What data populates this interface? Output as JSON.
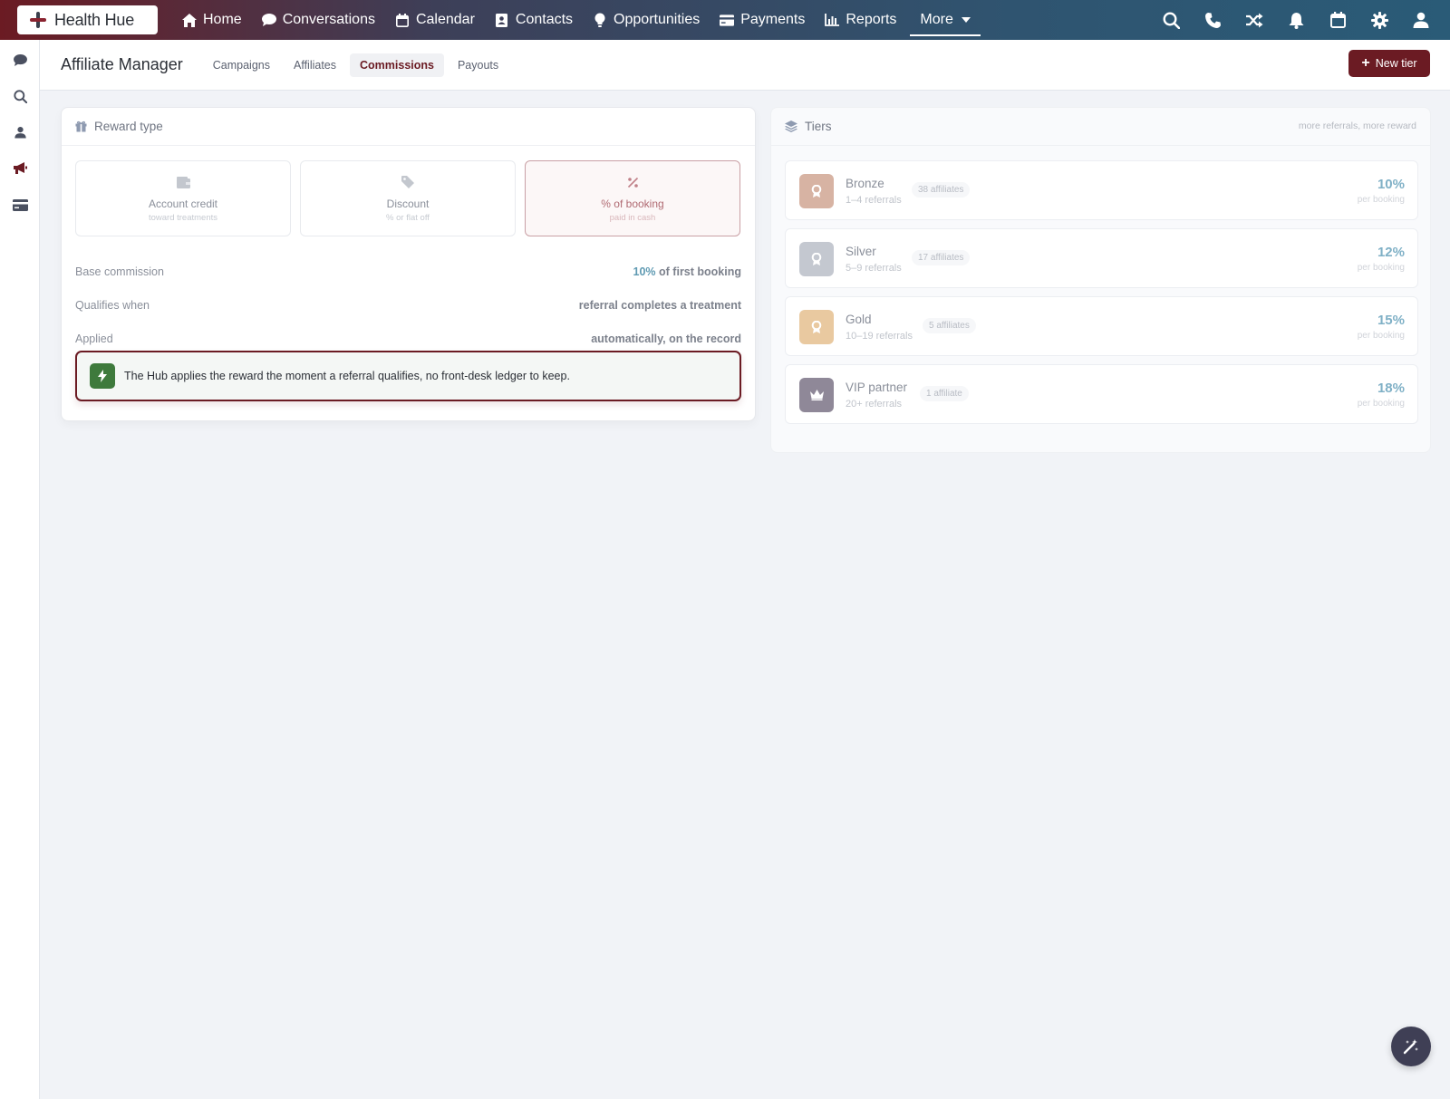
{
  "brand": {
    "name": "Health Hue"
  },
  "nav": {
    "items": [
      {
        "label": "Home",
        "icon": "home-icon"
      },
      {
        "label": "Conversations",
        "icon": "chat-icon"
      },
      {
        "label": "Calendar",
        "icon": "calendar-icon"
      },
      {
        "label": "Contacts",
        "icon": "contacts-icon"
      },
      {
        "label": "Opportunities",
        "icon": "lightbulb-icon"
      },
      {
        "label": "Payments",
        "icon": "card-icon"
      },
      {
        "label": "Reports",
        "icon": "chart-icon"
      }
    ],
    "more_label": "More",
    "right_icons": [
      "search-icon",
      "phone-icon",
      "shuffle-icon",
      "bell-icon",
      "calendar-icon",
      "gear-icon",
      "user-icon"
    ]
  },
  "rail": {
    "icons": [
      "chat-icon",
      "search-icon",
      "user-icon",
      "megaphone-icon",
      "card-icon"
    ],
    "active": "megaphone-icon"
  },
  "header": {
    "title": "Affiliate Manager",
    "tabs": [
      {
        "label": "Campaigns"
      },
      {
        "label": "Affiliates"
      },
      {
        "label": "Commissions"
      },
      {
        "label": "Payouts"
      }
    ],
    "active_tab": "Commissions",
    "new_tier_label": "New tier"
  },
  "reward": {
    "title": "Reward type",
    "options": [
      {
        "label": "Account credit",
        "sub": "toward treatments",
        "icon": "wallet-icon"
      },
      {
        "label": "Discount",
        "sub": "% or flat off",
        "icon": "tag-icon"
      },
      {
        "label": "% of booking",
        "sub": "paid in cash",
        "icon": "percent-icon"
      }
    ],
    "selected": "% of booking",
    "rows": [
      {
        "key": "Base commission",
        "value_highlight": "10%",
        "value": "of first booking"
      },
      {
        "key": "Qualifies when",
        "value": "referral completes a treatment"
      },
      {
        "key": "Applied",
        "value": "automatically, on the record"
      }
    ],
    "notice": "The Hub applies the reward the moment a referral qualifies, no front-desk ledger to keep."
  },
  "tiers": {
    "title": "Tiers",
    "hint": "more referrals, more reward",
    "items": [
      {
        "name": "Bronze",
        "range": "1–4 referrals",
        "count": "38 affiliates",
        "pct": "10%",
        "per": "per booking",
        "color": "#d7b3a3",
        "icon": "award-icon"
      },
      {
        "name": "Silver",
        "range": "5–9 referrals",
        "count": "17 affiliates",
        "pct": "12%",
        "per": "per booking",
        "color": "#c4c8d0",
        "icon": "award-icon"
      },
      {
        "name": "Gold",
        "range": "10–19 referrals",
        "count": "5 affiliates",
        "pct": "15%",
        "per": "per booking",
        "color": "#e9c9a0",
        "icon": "award-icon"
      },
      {
        "name": "VIP partner",
        "range": "20+ referrals",
        "count": "1 affiliate",
        "pct": "18%",
        "per": "per booking",
        "color": "#8f8898",
        "icon": "crown-icon"
      }
    ]
  },
  "colors": {
    "accent": "#6b1b23",
    "highlight": "#5f9ab2",
    "notice_icon": "#3e7a3c"
  }
}
